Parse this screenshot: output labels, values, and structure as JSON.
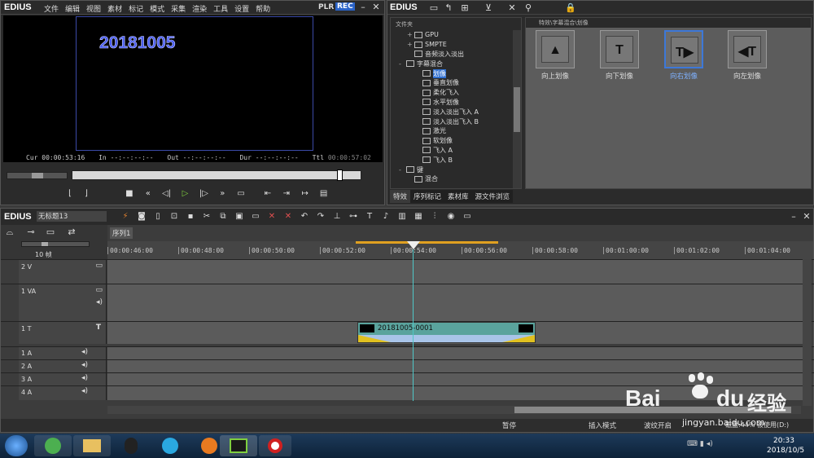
{
  "player": {
    "app": "EDIUS",
    "menu": [
      "文件",
      "编辑",
      "视图",
      "素材",
      "标记",
      "模式",
      "采集",
      "渲染",
      "工具",
      "设置",
      "帮助"
    ],
    "plr": "PLR",
    "rec": "REC",
    "overlay_text": "20181005",
    "cur_label": "Cur",
    "cur_value": "00:00:53:16",
    "in_label": "In",
    "in_value": "--:--:--:--",
    "out_label": "Out",
    "out_value": "--:--:--:--",
    "dur_label": "Dur",
    "dur_value": "--:--:--:--",
    "ttl_label": "Ttl",
    "ttl_value": "00:00:57:02"
  },
  "effects": {
    "app": "EDIUS",
    "folder_header": "文件夹",
    "path": "特效\\字幕混合\\划像",
    "tree": [
      {
        "indent": 1,
        "expander": "+",
        "label": "GPU"
      },
      {
        "indent": 1,
        "expander": "+",
        "label": "SMPTE"
      },
      {
        "indent": 1,
        "expander": "",
        "label": "音频淡入淡出"
      },
      {
        "indent": 0,
        "expander": "-",
        "label": "字幕混合"
      },
      {
        "indent": 2,
        "expander": "",
        "label": "划像",
        "selected": true
      },
      {
        "indent": 2,
        "expander": "",
        "label": "垂直划像"
      },
      {
        "indent": 2,
        "expander": "",
        "label": "柔化飞入"
      },
      {
        "indent": 2,
        "expander": "",
        "label": "水平划像"
      },
      {
        "indent": 2,
        "expander": "",
        "label": "淡入淡出飞入 A"
      },
      {
        "indent": 2,
        "expander": "",
        "label": "淡入淡出飞入 B"
      },
      {
        "indent": 2,
        "expander": "",
        "label": "激光"
      },
      {
        "indent": 2,
        "expander": "",
        "label": "软划像"
      },
      {
        "indent": 2,
        "expander": "",
        "label": "飞入 A"
      },
      {
        "indent": 2,
        "expander": "",
        "label": "飞入 B"
      },
      {
        "indent": 0,
        "expander": "-",
        "label": "键"
      },
      {
        "indent": 1,
        "expander": "",
        "label": "混合"
      }
    ],
    "thumbs": [
      "向上划像",
      "向下划像",
      "向右划像",
      "向左划像"
    ],
    "tabs": [
      "特效",
      "序列标记",
      "素材库",
      "源文件浏览"
    ]
  },
  "timeline": {
    "app": "EDIUS",
    "project": "无标题13",
    "sequence_tab": "序列1",
    "zoom": "10 帧",
    "ruler": [
      "00:00:46:00",
      "00:00:48:00",
      "00:00:50:00",
      "00:00:52:00",
      "00:00:54:00",
      "00:00:56:00",
      "00:00:58:00",
      "00:01:00:00",
      "00:01:02:00",
      "00:01:04:00"
    ],
    "tracks": {
      "v2": "2 V",
      "va1": "1 VA",
      "t1": "1 T",
      "a1": "1 A",
      "a2": "2 A",
      "a3": "3 A",
      "a4": "4 A"
    },
    "clip_name": "20181005-0001"
  },
  "status": {
    "pause": "暂停",
    "insert": "插入模式",
    "ripple": "波纹开启",
    "disk": "磁盘:44% 被使用(D:)"
  },
  "taskbar": {
    "time": "20:33",
    "date": "2018/10/5"
  },
  "watermark": {
    "brand": "Bai",
    "brand_cn": "经验",
    "url": "jingyan.baidu.com"
  }
}
